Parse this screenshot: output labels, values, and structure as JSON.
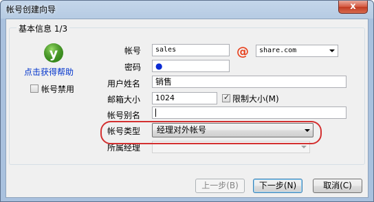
{
  "window": {
    "title": "帐号创建向导",
    "close_label": "x"
  },
  "group": {
    "title": "基本信息 1/3"
  },
  "sidebar": {
    "help_link": "点击获得帮助",
    "disable_account_label": "帐号禁用",
    "disable_account_checked": false
  },
  "form": {
    "account_label": "帐号",
    "account_value": "sales",
    "at_symbol": "@",
    "domain_value": "share.com",
    "password_label": "密码",
    "password_dot": "●",
    "username_label": "用户姓名",
    "username_value": "销售",
    "mailbox_size_label": "邮箱大小",
    "mailbox_size_value": "1024",
    "limit_size_label": "限制大小(M)",
    "limit_size_checked": true,
    "alias_label": "帐号别名",
    "alias_value": "",
    "account_type_label": "帐号类型",
    "account_type_value": "经理对外帐号",
    "manager_label": "所属经理",
    "manager_value": ""
  },
  "buttons": {
    "back": "上一步(B)",
    "next": "下一步(N)",
    "cancel": "取消(C)"
  },
  "colors": {
    "link": "#0033cc",
    "highlight": "#d32f2f",
    "at_icon": "#e8401c",
    "help_icon": "#3a8d1f"
  }
}
